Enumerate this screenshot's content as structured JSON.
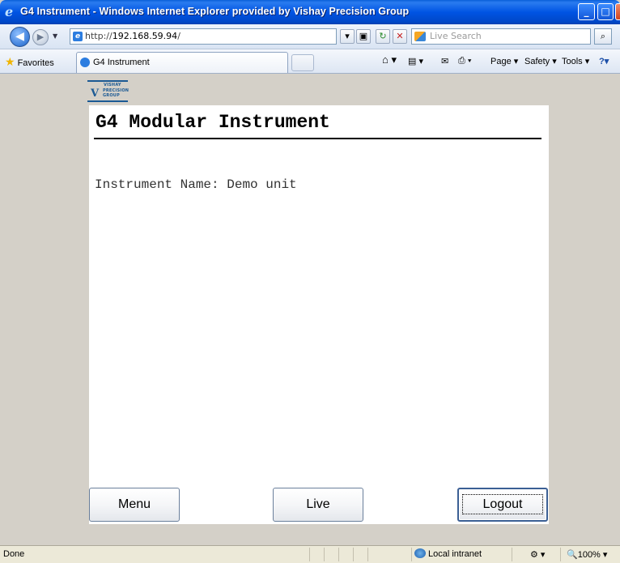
{
  "window": {
    "title": "G4 Instrument - Windows Internet Explorer provided by Vishay Precision Group",
    "ie_glyph": "e",
    "minimize": "_",
    "maximize": "□",
    "close": "✕"
  },
  "address_bar": {
    "url_scheme": "http://",
    "url_host": "192.168.59.94",
    "url_tail": "/",
    "search_placeholder": "Live Search"
  },
  "favorites_bar": {
    "favorites_label": "Favorites",
    "tab_title": "G4 Instrument",
    "commands": {
      "page": "Page",
      "safety": "Safety",
      "tools": "Tools"
    }
  },
  "logo": {
    "line1": "VISHAY",
    "line2": "PRECISION",
    "line3": "GROUP"
  },
  "page": {
    "title": "G4 Modular Instrument",
    "instrument_label": "Instrument Name:",
    "instrument_value": "Demo unit"
  },
  "buttons": {
    "menu": "Menu",
    "live": "Live",
    "logout": "Logout"
  },
  "status_bar": {
    "status": "Done",
    "zone": "Local intranet",
    "zoom": "100%"
  },
  "icons": [
    "back-icon",
    "forward-icon",
    "refresh-icon",
    "stop-icon",
    "search-icon",
    "home-icon",
    "feeds-icon",
    "mail-icon",
    "print-icon",
    "help-icon",
    "star-icon",
    "globe-icon"
  ]
}
